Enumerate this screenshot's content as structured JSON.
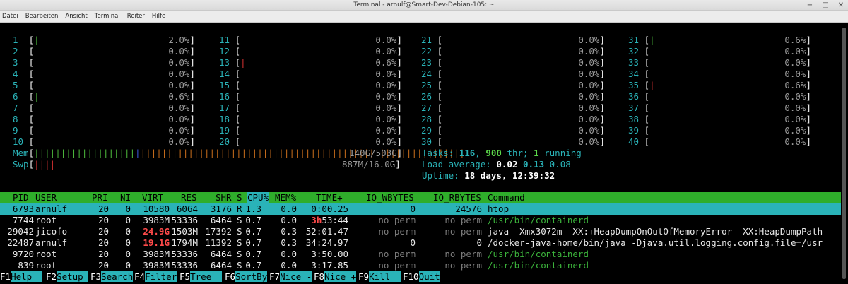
{
  "window": {
    "title": "Terminal - arnulf@Smart-Dev-Debian-105: ~",
    "btn_min": "−",
    "btn_max": "□",
    "btn_close": "✕"
  },
  "menu": [
    "Datei",
    "Bearbeiten",
    "Ansicht",
    "Terminal",
    "Reiter",
    "Hilfe"
  ],
  "cpus": [
    {
      "n": "1",
      "bar": "|",
      "c": "g",
      "p": "2.0%"
    },
    {
      "n": "2",
      "bar": "",
      "c": "g",
      "p": "0.0%"
    },
    {
      "n": "3",
      "bar": "",
      "c": "g",
      "p": "0.0%"
    },
    {
      "n": "4",
      "bar": "",
      "c": "g",
      "p": "0.0%"
    },
    {
      "n": "5",
      "bar": "",
      "c": "g",
      "p": "0.0%"
    },
    {
      "n": "6",
      "bar": "|",
      "c": "g",
      "p": "0.6%"
    },
    {
      "n": "7",
      "bar": "",
      "c": "g",
      "p": "0.0%"
    },
    {
      "n": "8",
      "bar": "",
      "c": "g",
      "p": "0.0%"
    },
    {
      "n": "9",
      "bar": "",
      "c": "g",
      "p": "0.0%"
    },
    {
      "n": "10",
      "bar": "",
      "c": "g",
      "p": "0.0%"
    },
    {
      "n": "11",
      "bar": "",
      "c": "g",
      "p": "0.0%"
    },
    {
      "n": "12",
      "bar": "",
      "c": "g",
      "p": "0.0%"
    },
    {
      "n": "13",
      "bar": "|",
      "c": "r",
      "p": "0.6%"
    },
    {
      "n": "14",
      "bar": "",
      "c": "g",
      "p": "0.0%"
    },
    {
      "n": "15",
      "bar": "",
      "c": "g",
      "p": "0.0%"
    },
    {
      "n": "16",
      "bar": "",
      "c": "g",
      "p": "0.0%"
    },
    {
      "n": "17",
      "bar": "",
      "c": "g",
      "p": "0.0%"
    },
    {
      "n": "18",
      "bar": "",
      "c": "g",
      "p": "0.0%"
    },
    {
      "n": "19",
      "bar": "",
      "c": "g",
      "p": "0.0%"
    },
    {
      "n": "20",
      "bar": "",
      "c": "g",
      "p": "0.0%"
    },
    {
      "n": "21",
      "bar": "",
      "c": "g",
      "p": "0.0%"
    },
    {
      "n": "22",
      "bar": "",
      "c": "g",
      "p": "0.0%"
    },
    {
      "n": "23",
      "bar": "",
      "c": "g",
      "p": "0.0%"
    },
    {
      "n": "24",
      "bar": "",
      "c": "g",
      "p": "0.0%"
    },
    {
      "n": "25",
      "bar": "",
      "c": "g",
      "p": "0.0%"
    },
    {
      "n": "26",
      "bar": "",
      "c": "g",
      "p": "0.0%"
    },
    {
      "n": "27",
      "bar": "",
      "c": "g",
      "p": "0.0%"
    },
    {
      "n": "28",
      "bar": "",
      "c": "g",
      "p": "0.0%"
    },
    {
      "n": "29",
      "bar": "",
      "c": "g",
      "p": "0.0%"
    },
    {
      "n": "30",
      "bar": "",
      "c": "g",
      "p": "0.0%"
    },
    {
      "n": "31",
      "bar": "|",
      "c": "g",
      "p": "0.6%"
    },
    {
      "n": "32",
      "bar": "",
      "c": "g",
      "p": "0.0%"
    },
    {
      "n": "33",
      "bar": "",
      "c": "g",
      "p": "0.0%"
    },
    {
      "n": "34",
      "bar": "",
      "c": "g",
      "p": "0.0%"
    },
    {
      "n": "35",
      "bar": "|",
      "c": "r",
      "p": "0.6%"
    },
    {
      "n": "36",
      "bar": "",
      "c": "g",
      "p": "0.0%"
    },
    {
      "n": "37",
      "bar": "",
      "c": "g",
      "p": "0.0%"
    },
    {
      "n": "38",
      "bar": "",
      "c": "g",
      "p": "0.0%"
    },
    {
      "n": "39",
      "bar": "",
      "c": "g",
      "p": "0.0%"
    },
    {
      "n": "40",
      "bar": "",
      "c": "g",
      "p": "0.0%"
    }
  ],
  "mem": {
    "label": "Mem",
    "bar_green": "|||||||||||||||||||",
    "bar_blue": "|",
    "bar_orange": "|||||||||||||||||||||||||||||||||||||||||||||||||||||||||||||",
    "value": "140G/503G"
  },
  "swp": {
    "label": "Swp",
    "bar_red": "||||",
    "value": "887M/16.0G"
  },
  "tasks": {
    "label": "Tasks:",
    "tasks": "116",
    "sep1": ",",
    "threads": "900",
    "thr_label": " thr;",
    "running": "1",
    "run_label": " running"
  },
  "load": {
    "label": "Load average:",
    "l1": "0.02",
    "l5": "0.13",
    "l15": "0.08"
  },
  "uptime": {
    "label": "Uptime:",
    "value": "18 days, 12:39:32"
  },
  "header": {
    "pid": "PID",
    "user": "USER",
    "pri": "PRI",
    "ni": "NI",
    "virt": "VIRT",
    "res": "RES",
    "shr": "SHR",
    "s": "S",
    "cpu": "CPU%",
    "mem": "MEM%",
    "time": "TIME+",
    "iow": "IO_WBYTES",
    "ior": "IO_RBYTES",
    "cmd": "Command"
  },
  "processes": [
    {
      "pid": "6793",
      "user": "arnulf",
      "pri": "20",
      "ni": "0",
      "virt": "10580",
      "res": "6064",
      "shr": "3176",
      "s": "R",
      "cpu": "1.3",
      "mem": "0.0",
      "time": "0:00.25",
      "iow": "0",
      "ior": "24576",
      "cmd": "htop"
    },
    {
      "pid": "7744",
      "user": "root",
      "pri": "20",
      "ni": "0",
      "virt": "3983M",
      "res": "53336",
      "shr": "6464",
      "s": "S",
      "cpu": "0.7",
      "mem": "0.0",
      "time_h": "3h",
      "time": "53:44",
      "iow": "no perm",
      "ior": "no perm",
      "cmd": "/usr/bin/containerd"
    },
    {
      "pid": "29042",
      "user": "jicofo",
      "pri": "20",
      "ni": "0",
      "virt": "24.9G",
      "res": "1503M",
      "shr": "17392",
      "s": "S",
      "cpu": "0.7",
      "mem": "0.3",
      "time": "52:01.47",
      "iow": "no perm",
      "ior": "no perm",
      "cmd": "java -Xmx3072m -XX:+HeapDumpOnOutOfMemoryError -XX:HeapDumpPath"
    },
    {
      "pid": "22487",
      "user": "arnulf",
      "pri": "20",
      "ni": "0",
      "virt": "19.1G",
      "res": "1794M",
      "shr": "11392",
      "s": "S",
      "cpu": "0.7",
      "mem": "0.3",
      "time": "34:24.97",
      "iow": "0",
      "ior": "0",
      "cmd": "/docker-java-home/bin/java -Djava.util.logging.config.file=/usr"
    },
    {
      "pid": "9720",
      "user": "root",
      "pri": "20",
      "ni": "0",
      "virt": "3983M",
      "res": "53336",
      "shr": "6464",
      "s": "S",
      "cpu": "0.7",
      "mem": "0.0",
      "time": "3:50.00",
      "iow": "no perm",
      "ior": "no perm",
      "cmd": "/usr/bin/containerd"
    },
    {
      "pid": "839",
      "user": "root",
      "pri": "20",
      "ni": "0",
      "virt": "3983M",
      "res": "53336",
      "shr": "6464",
      "s": "S",
      "cpu": "0.7",
      "mem": "0.0",
      "time": "3:17.85",
      "iow": "no perm",
      "ior": "no perm",
      "cmd": "/usr/bin/containerd"
    }
  ],
  "fkeys": [
    {
      "k": "F1",
      "l": "Help  "
    },
    {
      "k": "F2",
      "l": "Setup "
    },
    {
      "k": "F3",
      "l": "Search"
    },
    {
      "k": "F4",
      "l": "Filter"
    },
    {
      "k": "F5",
      "l": "Tree  "
    },
    {
      "k": "F6",
      "l": "SortBy"
    },
    {
      "k": "F7",
      "l": "Nice -"
    },
    {
      "k": "F8",
      "l": "Nice +"
    },
    {
      "k": "F9",
      "l": "Kill  "
    },
    {
      "k": "F10",
      "l": "Quit"
    }
  ],
  "colors": {
    "cyan": "#2ab3b8",
    "green": "#2fae2b",
    "red": "#ff4a4a",
    "bg": "#000000"
  }
}
